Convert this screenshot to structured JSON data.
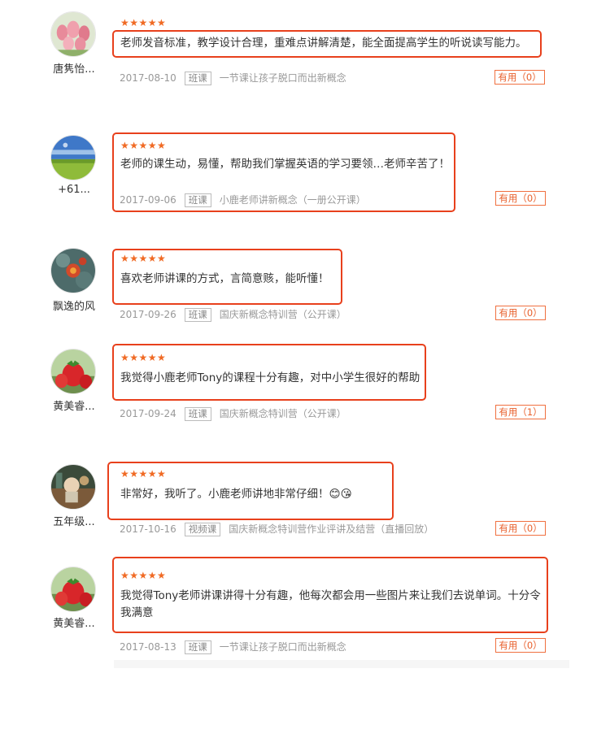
{
  "colors": {
    "accent": "#e8401c",
    "star": "#f06a24",
    "meta": "#999999"
  },
  "reviews": [
    {
      "username": "唐隽怡...",
      "avatar_icon": "tulips-avatar-icon",
      "stars": "★★★★★",
      "rating": 5,
      "text": "老师发音标准，教学设计合理，重难点讲解清楚，能全面提高学生的听说读写能力。",
      "date": "2017-08-10",
      "tag": "班课",
      "course": "一节课让孩子脱口而出新概念",
      "useful": "有用（0）"
    },
    {
      "username": "+61...",
      "avatar_icon": "landscape-avatar-icon",
      "stars": "★★★★★",
      "rating": 5,
      "text": "老师的课生动，易懂，帮助我们掌握英语的学习要领…老师辛苦了！",
      "date": "2017-09-06",
      "tag": "班课",
      "course": "小鹿老师讲新概念（一册公开课）",
      "useful": "有用（0）"
    },
    {
      "username": "飘逸的风",
      "avatar_icon": "flower-avatar-icon",
      "stars": "★★★★★",
      "rating": 5,
      "text": "喜欢老师讲课的方式，言简意赅，能听懂！",
      "date": "2017-09-26",
      "tag": "班课",
      "course": "国庆新概念特训营（公开课）",
      "useful": "有用（0）"
    },
    {
      "username": "黄美睿...",
      "avatar_icon": "strawberry-avatar-icon",
      "stars": "★★★★★",
      "rating": 5,
      "text": "我觉得小鹿老师Tony的课程十分有趣，对中小学生很好的帮助",
      "date": "2017-09-24",
      "tag": "班课",
      "course": "国庆新概念特训营（公开课）",
      "useful": "有用（1）"
    },
    {
      "username": "五年级...",
      "avatar_icon": "character-avatar-icon",
      "stars": "★★★★★",
      "rating": 5,
      "text": "非常好，我听了。小鹿老师讲地非常仔细！😊😘",
      "date": "2017-10-16",
      "tag": "视频课",
      "course": "国庆新概念特训营作业评讲及结营（直播回放）",
      "useful": "有用（0）"
    },
    {
      "username": "黄美睿...",
      "avatar_icon": "strawberry-avatar-icon",
      "stars": "★★★★★",
      "rating": 5,
      "text": "我觉得Tony老师讲课讲得十分有趣，他每次都会用一些图片来让我们去说单词。十分令我满意",
      "date": "2017-08-13",
      "tag": "班课",
      "course": "一节课让孩子脱口而出新概念",
      "useful": "有用（0）"
    }
  ]
}
